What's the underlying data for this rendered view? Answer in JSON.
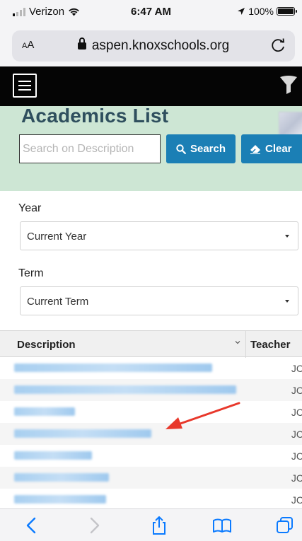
{
  "status_bar": {
    "carrier": "Verizon",
    "time": "6:47 AM",
    "battery": "100%",
    "battery_level": 1.0,
    "icons": [
      "signal-icon",
      "wifi-icon",
      "location-icon",
      "battery-icon"
    ]
  },
  "browser": {
    "text_size_label": "AA",
    "url": "aspen.knoxschools.org",
    "icons": [
      "lock-icon",
      "reload-icon"
    ]
  },
  "app_header": {
    "icons": [
      "hamburger-menu-icon",
      "filter-funnel-icon"
    ]
  },
  "page": {
    "title": "Academics List",
    "search": {
      "placeholder": "Search on Description",
      "value": "",
      "button_label": "Search"
    },
    "clear_button_label": "Clear"
  },
  "filters": {
    "year": {
      "label": "Year",
      "selected": "Current Year"
    },
    "term": {
      "label": "Term",
      "selected": "Current Term"
    }
  },
  "table": {
    "columns": [
      "Description",
      "Teacher"
    ],
    "rows": [
      {
        "description": "",
        "teacher": "JC"
      },
      {
        "description": "",
        "teacher": "JC"
      },
      {
        "description": "",
        "teacher": "JC"
      },
      {
        "description": "",
        "teacher": "JC"
      },
      {
        "description": "",
        "teacher": "JC"
      },
      {
        "description": "",
        "teacher": "JC"
      },
      {
        "description": "",
        "teacher": "JC"
      }
    ]
  },
  "colors": {
    "accent_blue": "#1b7fb5",
    "header_green": "#cde6d4",
    "title_color": "#2f4f5e",
    "ios_blue": "#0a7aff",
    "annotation_arrow": "#e8382b"
  },
  "toolbar": {
    "icons": [
      "back-icon",
      "forward-icon",
      "share-icon",
      "bookmarks-icon",
      "tabs-icon"
    ]
  }
}
